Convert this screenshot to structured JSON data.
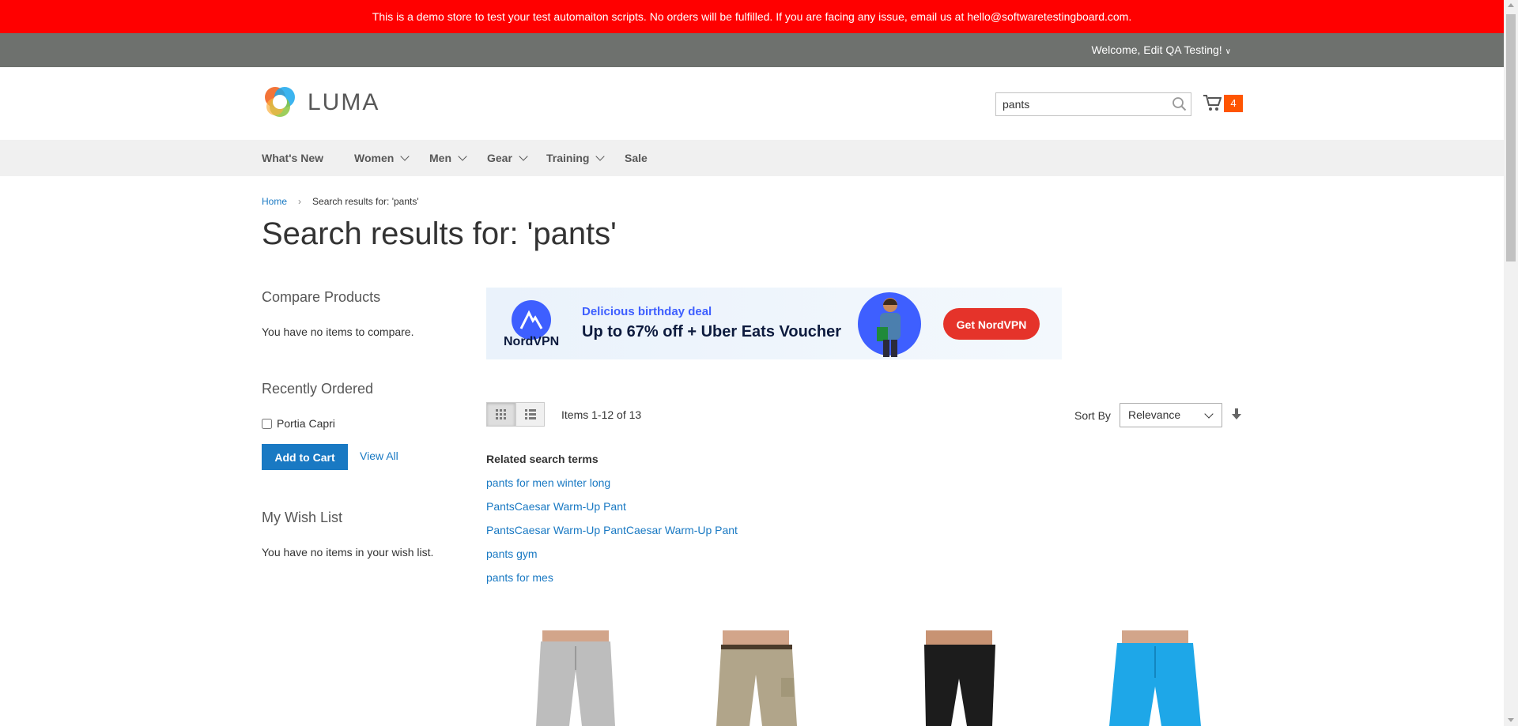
{
  "promo": {
    "text": "This is a demo store to test your test automaiton scripts. No orders will be fulfilled. If you are facing any issue, email us at hello@softwaretestingboard.com."
  },
  "header": {
    "welcome": "Welcome, Edit QA Testing!"
  },
  "logo": {
    "text": "LUMA"
  },
  "search": {
    "value": "pants"
  },
  "cart": {
    "count": "4"
  },
  "nav": {
    "items": [
      {
        "label": "What's New"
      },
      {
        "label": "Women"
      },
      {
        "label": "Men"
      },
      {
        "label": "Gear"
      },
      {
        "label": "Training"
      },
      {
        "label": "Sale"
      }
    ]
  },
  "breadcrumb": {
    "home": "Home",
    "current": "Search results for: 'pants'"
  },
  "page": {
    "title": "Search results for: 'pants'"
  },
  "sidebar": {
    "compare_title": "Compare Products",
    "compare_empty": "You have no items to compare.",
    "recent_title": "Recently Ordered",
    "recent_item": "Portia Capri",
    "add_to_cart": "Add to Cart",
    "view_all": "View All",
    "wishlist_title": "My Wish List",
    "wishlist_empty": "You have no items in your wish list."
  },
  "banner": {
    "brand": "NordVPN",
    "deal": "Delicious birthday deal",
    "offer": "Up to 67% off + Uber Eats Voucher",
    "cta": "Get NordVPN"
  },
  "toolbar": {
    "amount": "Items 1-12 of 13",
    "sort_label": "Sort By",
    "sort_value": "Relevance"
  },
  "related": {
    "title": "Related search terms",
    "terms": [
      "pants for men winter long",
      "PantsCaesar Warm-Up Pant",
      "PantsCaesar Warm-Up PantCaesar Warm-Up Pant",
      "pants gym",
      "pants for mes"
    ]
  },
  "colors": {
    "promo_bg": "#ff0000",
    "panel_bg": "#6e716e",
    "link": "#1979c3",
    "cart_badge": "#ff5501",
    "primary_button": "#1979c3"
  },
  "icons": {
    "search": "search-icon",
    "cart": "cart-icon",
    "grid": "grid-view-icon",
    "list": "list-view-icon",
    "sort_direction": "sort-arrow-down-icon"
  }
}
